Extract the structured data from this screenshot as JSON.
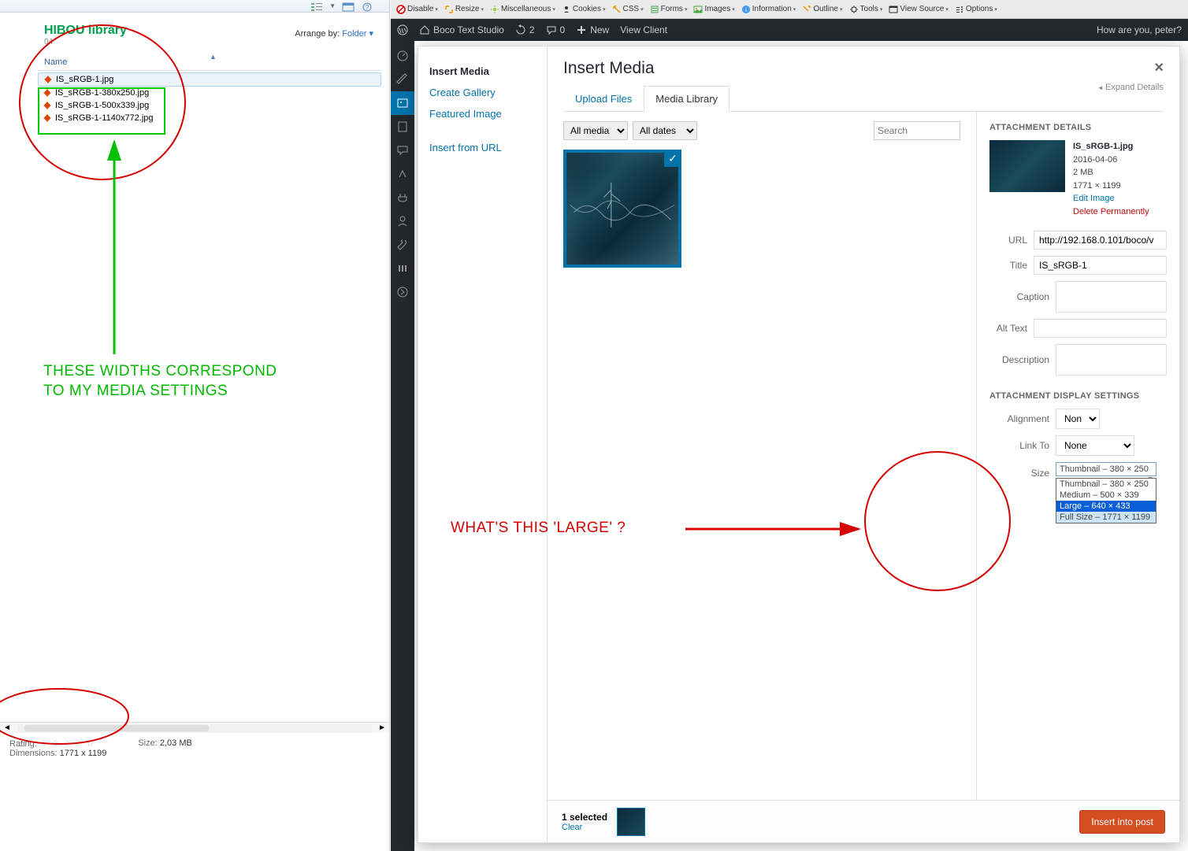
{
  "left": {
    "folder_title": "HIBOU library",
    "folder_sub": "04",
    "arrange_label": "Arrange by:",
    "arrange_value": "Folder ▾",
    "name_col": "Name",
    "files": [
      "IS_sRGB-1.jpg",
      "IS_sRGB-1-380x250.jpg",
      "IS_sRGB-1-500x339.jpg",
      "IS_sRGB-1-1140x772.jpg"
    ],
    "rating_label": "Rating:",
    "size_label": "Size:",
    "size_value": "2,03 MB",
    "dimensions_label": "Dimensions:",
    "dimensions_value": "1771 x 1199"
  },
  "devtools": [
    "Disable",
    "Resize",
    "Miscellaneous",
    "Cookies",
    "CSS",
    "Forms",
    "Images",
    "Information",
    "Outline",
    "Tools",
    "View Source",
    "Options"
  ],
  "wpbar": {
    "site": "Boco Text Studio",
    "updates": "2",
    "comments": "0",
    "new": "New",
    "view": "View Client",
    "greeting": "How are you, peter?"
  },
  "modal": {
    "left_items": [
      "Insert Media",
      "Create Gallery",
      "Featured Image"
    ],
    "left_item_sep": "Insert from URL",
    "title": "Insert Media",
    "close": "×",
    "expand": "Expand Details",
    "tabs": [
      "Upload Files",
      "Media Library"
    ],
    "filter_type": "All media items",
    "filter_date": "All dates",
    "search_placeholder": "Search"
  },
  "details": {
    "heading": "ATTACHMENT DETAILS",
    "filename": "IS_sRGB-1.jpg",
    "date": "2016-04-06",
    "filesize": "2 MB",
    "dims": "1771 × 1199",
    "edit": "Edit Image",
    "delete": "Delete Permanently",
    "url_label": "URL",
    "url_value": "http://192.168.0.101/boco/v",
    "title_label": "Title",
    "title_value": "IS_sRGB-1",
    "caption_label": "Caption",
    "alt_label": "Alt Text",
    "desc_label": "Description",
    "display_heading": "ATTACHMENT DISPLAY SETTINGS",
    "align_label": "Alignment",
    "align_value": "None",
    "linkto_label": "Link To",
    "linkto_value": "None",
    "size_label": "Size",
    "size_selected": "Thumbnail – 380 × 250",
    "size_options": [
      "Thumbnail – 380 × 250",
      "Medium – 500 × 339",
      "Large – 640 × 433",
      "Full Size – 1771 × 1199"
    ]
  },
  "footer": {
    "selected": "1 selected",
    "clear": "Clear",
    "insert": "Insert into post"
  },
  "annotations": {
    "green": "THESE WIDTHS CORRESPOND\nTO MY MEDIA SETTINGS",
    "red": "WHAT'S THIS 'LARGE' ?"
  }
}
